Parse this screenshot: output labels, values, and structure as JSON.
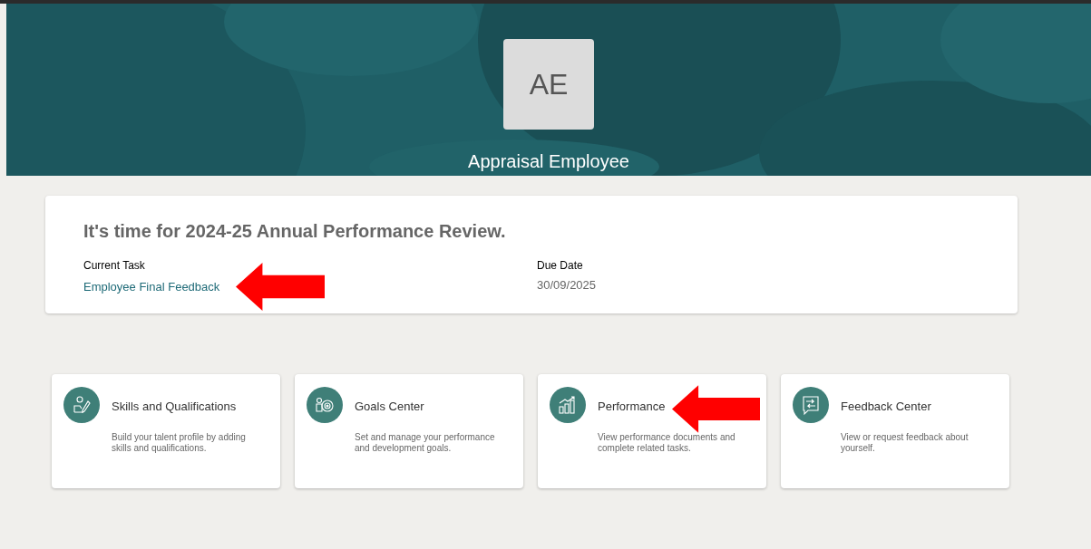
{
  "profile": {
    "initials": "AE",
    "name": "Appraisal Employee"
  },
  "review": {
    "heading": "It's time for 2024-25 Annual Performance Review.",
    "task_label": "Current Task",
    "task_link": "Employee Final Feedback",
    "due_label": "Due Date",
    "due_date": "30/09/2025"
  },
  "cards": [
    {
      "title": "Skills and Qualifications",
      "description": "Build your talent profile by adding skills and qualifications."
    },
    {
      "title": "Goals Center",
      "description": "Set and manage your performance and development goals."
    },
    {
      "title": "Performance",
      "description": "View performance documents and complete related tasks."
    },
    {
      "title": "Feedback Center",
      "description": "View or request feedback about yourself."
    }
  ]
}
